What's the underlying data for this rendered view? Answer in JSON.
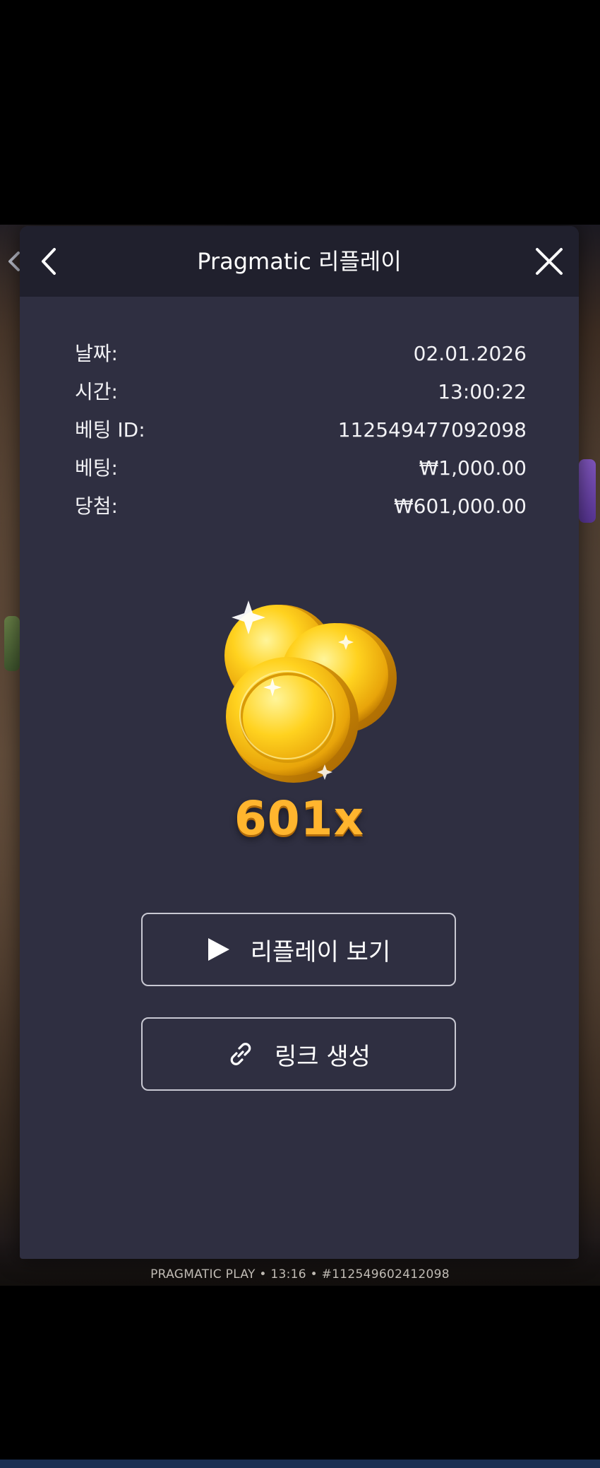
{
  "header": {
    "title": "Pragmatic 리플레이",
    "back_icon": "chevron-left-icon",
    "close_icon": "close-icon"
  },
  "info": [
    {
      "label": "날짜:",
      "value": "02.01.2026"
    },
    {
      "label": "시간:",
      "value": "13:00:22"
    },
    {
      "label": "베팅 ID:",
      "value": "112549477092098"
    },
    {
      "label": "베팅:",
      "value": "₩1,000.00"
    },
    {
      "label": "당첨:",
      "value": "₩601,000.00"
    }
  ],
  "win": {
    "multiplier": "601x",
    "icon": "gold-coins-icon"
  },
  "buttons": {
    "replay": {
      "label": "리플레이 보기",
      "icon": "play-icon"
    },
    "link": {
      "label": "링크 생성",
      "icon": "link-icon"
    }
  },
  "background": {
    "footer": "PRAGMATIC PLAY • 13:16 • #112549602412098"
  },
  "colors": {
    "modal_bg": "#2f2f41",
    "header_bg": "#20202d",
    "multiplier": "#ffb52e",
    "button_border": "#c8c8d2"
  }
}
